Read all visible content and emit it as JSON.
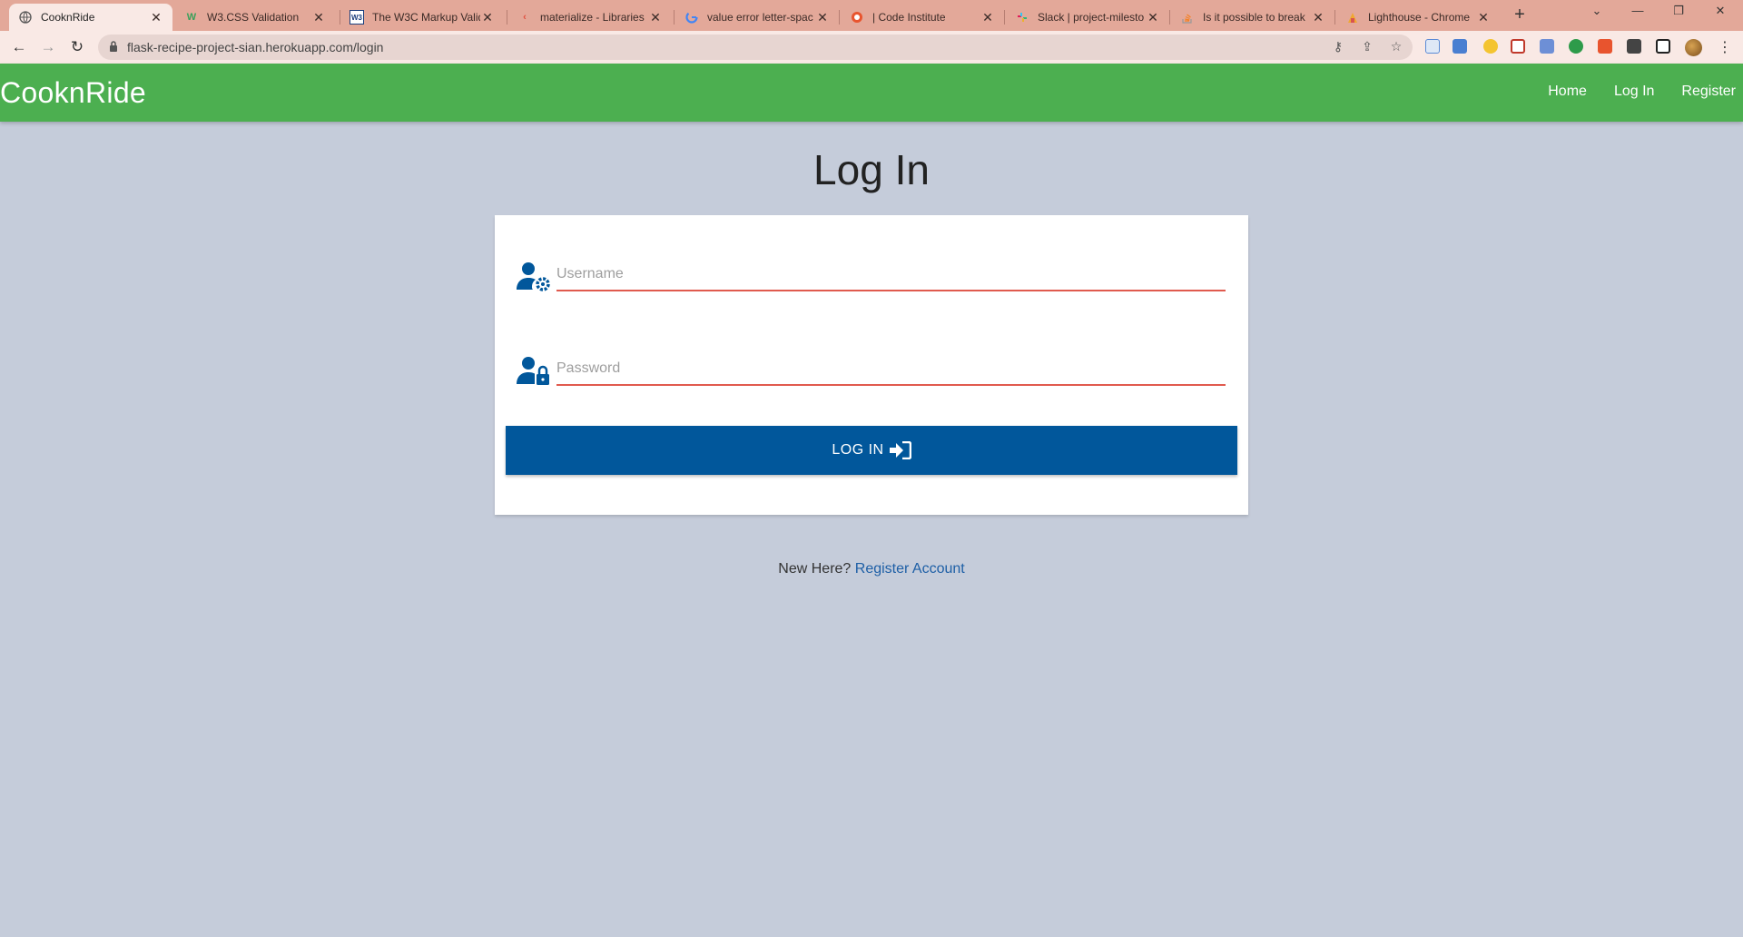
{
  "browser": {
    "tabs": [
      {
        "title": "CooknRide",
        "active": true,
        "icon": "globe-icon"
      },
      {
        "title": "W3.CSS Validation",
        "icon": "w3-validation-icon"
      },
      {
        "title": "The W3C Markup Valid",
        "icon": "w3c-icon"
      },
      {
        "title": "materialize - Libraries",
        "icon": "code-icon"
      },
      {
        "title": "value error letter-spac",
        "icon": "google-icon"
      },
      {
        "title": "| Code Institute",
        "icon": "code-institute-icon"
      },
      {
        "title": "Slack | project-milesto",
        "icon": "slack-icon"
      },
      {
        "title": "Is it possible to break",
        "icon": "stackoverflow-icon"
      },
      {
        "title": "Lighthouse - Chrome",
        "icon": "lighthouse-icon"
      }
    ],
    "url": "flask-recipe-project-sian.herokuapp.com/login",
    "colors": {
      "tabbar": "#e3a899",
      "toolbar": "#f9e9e5"
    }
  },
  "site": {
    "brand": "CooknRide",
    "nav": [
      "Home",
      "Log In",
      "Register"
    ],
    "colors": {
      "navbar": "#4caf50",
      "button": "#01579b",
      "underline": "#e05a4e",
      "background": "#c5ccda"
    }
  },
  "form": {
    "title": "Log In",
    "username_placeholder": "Username",
    "password_placeholder": "Password",
    "submit_label": "LOG IN",
    "new_here": "New Here?",
    "register_link": "Register Account"
  }
}
